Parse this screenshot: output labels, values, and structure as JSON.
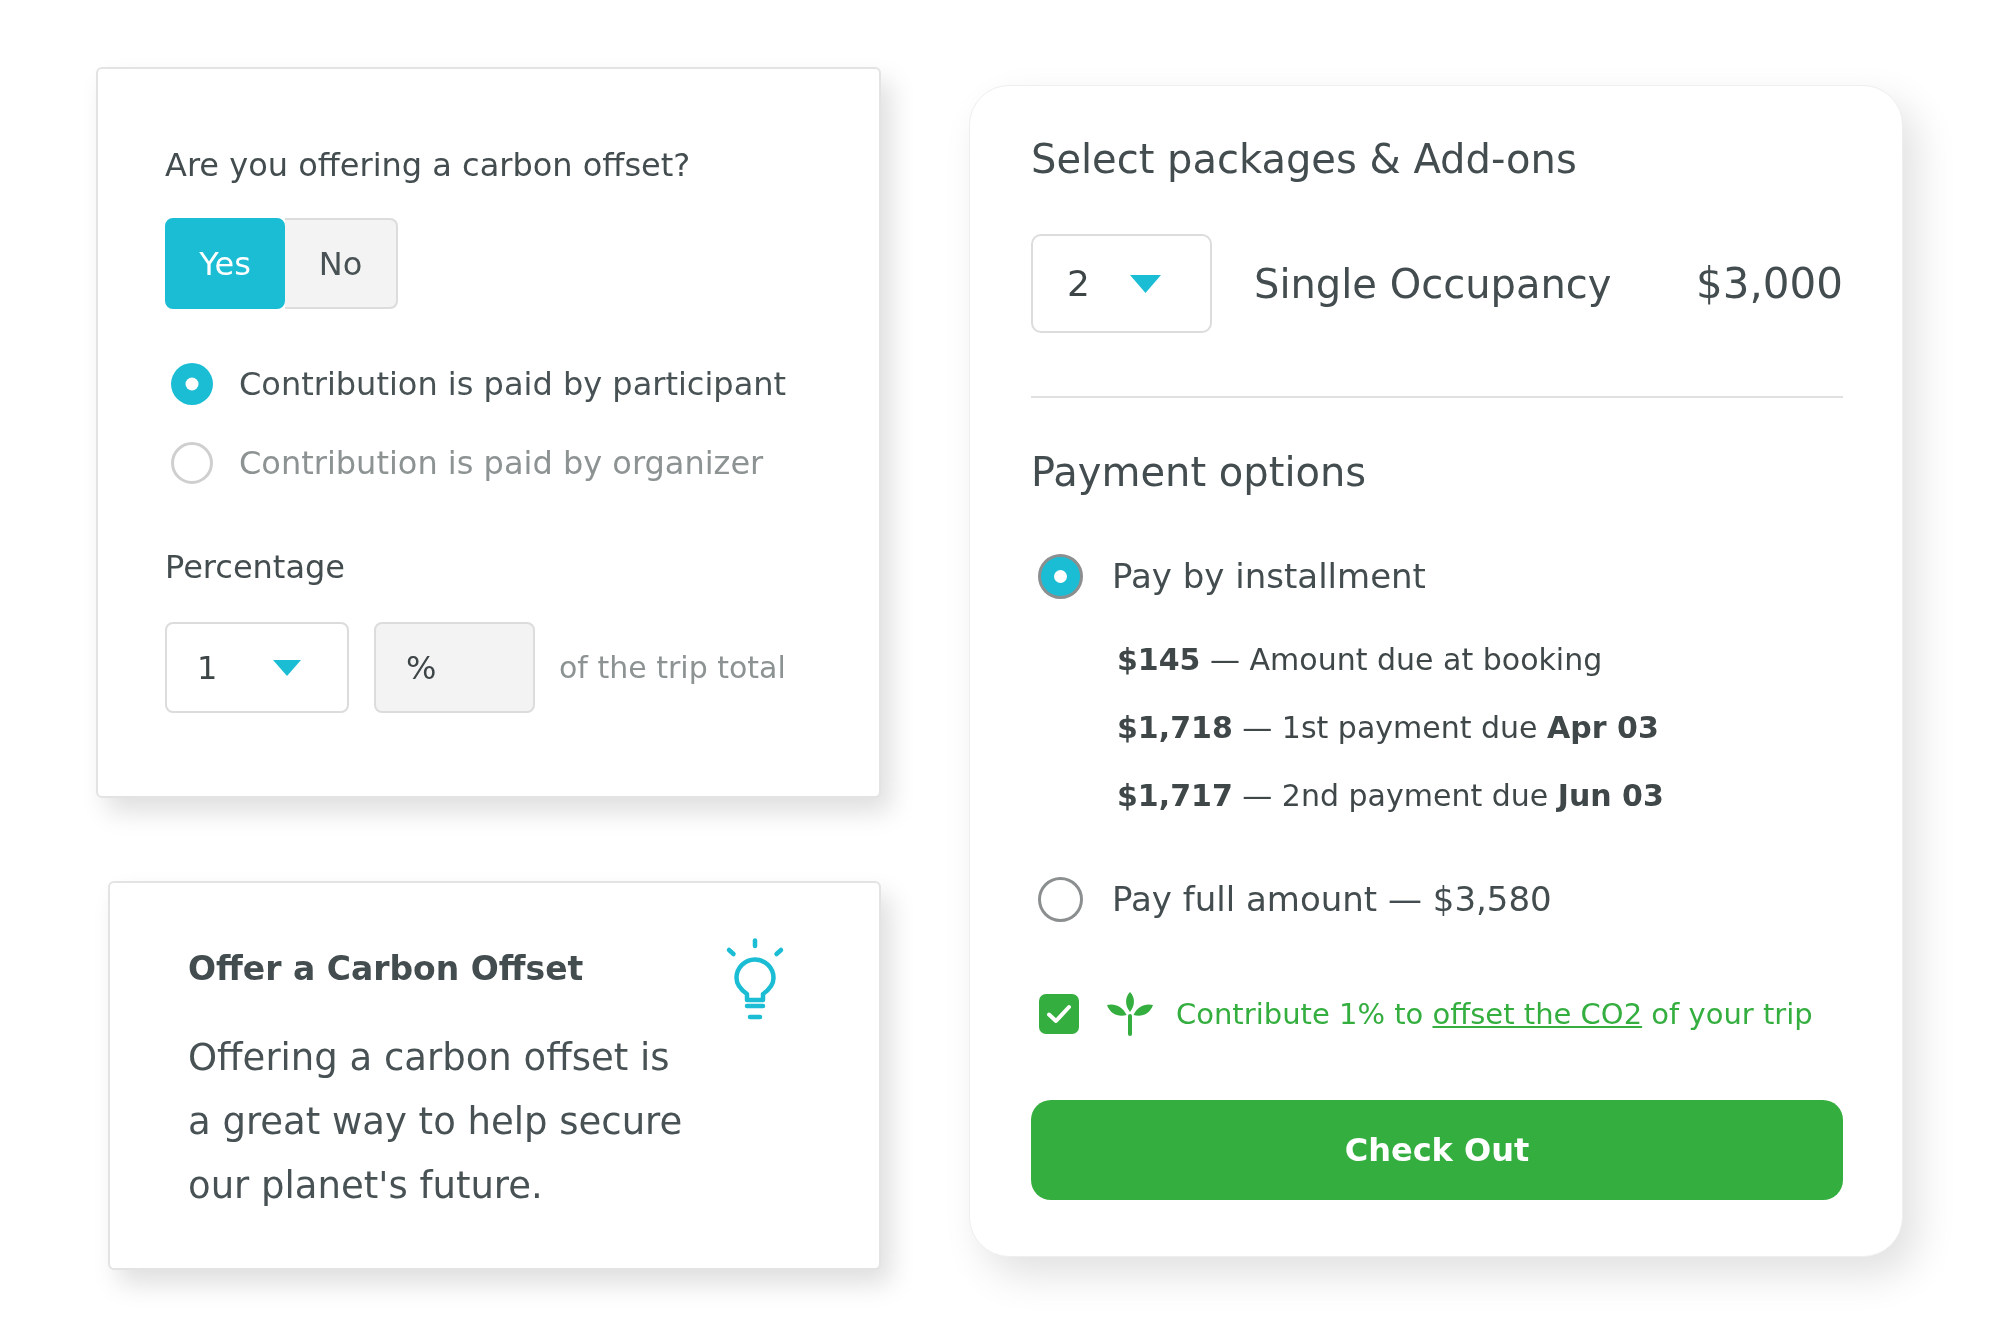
{
  "offset_settings_card": {
    "question": "Are you offering a carbon offset?",
    "toggle": [
      {
        "label": "Yes",
        "selected": true
      },
      {
        "label": "No",
        "selected": false
      }
    ],
    "payer_options": [
      {
        "label": "Contribution is paid by participant",
        "selected": true
      },
      {
        "label": "Contribution is paid by organizer",
        "selected": false
      }
    ],
    "percentage": {
      "label": "Percentage",
      "value": "1",
      "unit": "%",
      "suffix": "of the trip total"
    }
  },
  "info_card": {
    "title": "Offer a Carbon Offset",
    "text": "Offering a carbon offset is a great way to help secure our planet's future."
  },
  "checkout_card": {
    "title": "Select packages & Add-ons",
    "package": {
      "quantity": "2",
      "name": "Single Occupancy",
      "price": "$3,000"
    },
    "payment_title": "Payment options",
    "payment_options": [
      {
        "label": "Pay by installment",
        "selected": true,
        "schedule": [
          "**$145** — Amount due at booking",
          "**$1,718** — 1st payment due **Apr 03**",
          "**$1,717** — 2nd payment due **Jun 03**"
        ]
      },
      {
        "label": "Pay full amount — $3,580",
        "selected": false
      }
    ],
    "offset_checkbox": {
      "checked": true,
      "text_before": "Contribute 1% to",
      "link": "offset the CO2",
      "text_after": "of your trip"
    },
    "checkout_button": "Check Out"
  }
}
